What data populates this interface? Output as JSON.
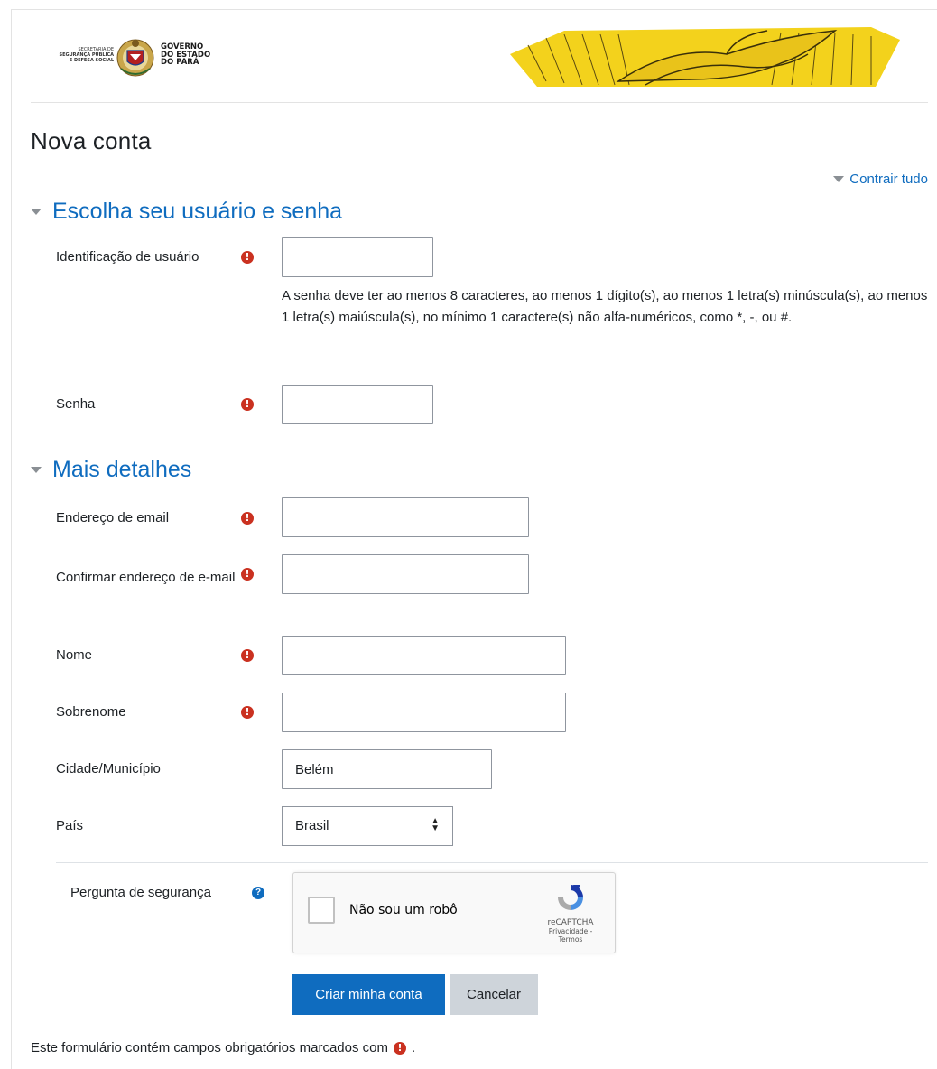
{
  "header": {
    "secretaria_line1": "SECRETARIA DE",
    "secretaria_line2": "SEGURANÇA PÚBLICA",
    "secretaria_line3": "E DEFESA SOCIAL",
    "gov_line1": "GOVERNO",
    "gov_line2": "DO ESTADO",
    "gov_line3": "DO PARÁ"
  },
  "page": {
    "title": "Nova conta",
    "collapse_all": "Contrair tudo"
  },
  "section_user": {
    "heading": "Escolha seu usuário e senha",
    "username_label": "Identificação de usuário",
    "username_value": "",
    "password_policy": "A senha deve ter ao menos 8 caracteres, ao menos 1 dígito(s), ao menos 1 letra(s) minúscula(s), ao menos 1 letra(s) maiúscula(s), no mínimo 1 caractere(s) não alfa-numéricos, como *, -, ou #.",
    "password_label": "Senha",
    "password_value": ""
  },
  "section_details": {
    "heading": "Mais detalhes",
    "email_label": "Endereço de email",
    "email_value": "",
    "email_confirm_label": "Confirmar endereço de e-mail",
    "email_confirm_value": "",
    "firstname_label": "Nome",
    "firstname_value": "",
    "lastname_label": "Sobrenome",
    "lastname_value": "",
    "city_label": "Cidade/Município",
    "city_value": "Belém",
    "country_label": "País",
    "country_value": "Brasil"
  },
  "security": {
    "label": "Pergunta de segurança",
    "recaptcha_label": "Não sou um robô",
    "recaptcha_brand": "reCAPTCHA",
    "recaptcha_links": "Privacidade - Termos"
  },
  "buttons": {
    "submit": "Criar minha conta",
    "cancel": "Cancelar"
  },
  "footer": {
    "required_note": "Este formulário contém campos obrigatórios marcados com",
    "required_note_end": "."
  },
  "colors": {
    "link": "#0f6cbf",
    "required": "#ca3120",
    "button_primary": "#0f6cbf",
    "button_secondary": "#ced4da"
  },
  "icons": {
    "required": "exclamation-circle-icon",
    "help": "question-circle-icon",
    "collapse": "triangle-down-icon"
  }
}
